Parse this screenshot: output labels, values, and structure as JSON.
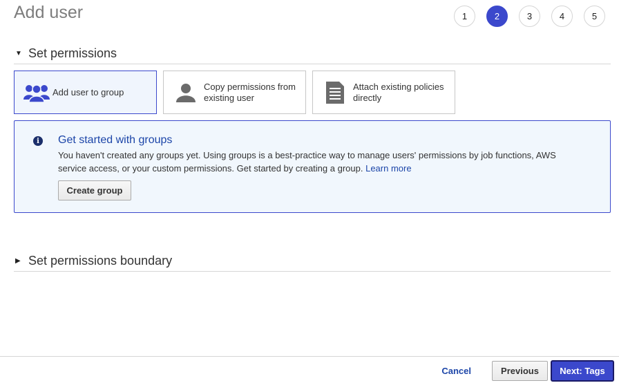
{
  "page": {
    "title": "Add user"
  },
  "stepper": {
    "steps": [
      "1",
      "2",
      "3",
      "4",
      "5"
    ],
    "active": 1
  },
  "set_permissions": {
    "header": "Set permissions",
    "options": [
      {
        "label": "Add user to group",
        "icon": "group-icon",
        "selected": true
      },
      {
        "label": "Copy permissions from existing user",
        "icon": "user-icon",
        "selected": false
      },
      {
        "label": "Attach existing policies directly",
        "icon": "document-icon",
        "selected": false
      }
    ]
  },
  "info_box": {
    "icon": "info-icon",
    "title": "Get started with groups",
    "text": "You haven't created any groups yet. Using groups is a best-practice way to manage users' permissions by job functions, AWS service access, or your custom permissions. Get started by creating a group.",
    "link": "Learn more",
    "button": "Create group"
  },
  "boundary": {
    "header": "Set permissions boundary"
  },
  "footer": {
    "cancel": "Cancel",
    "previous": "Previous",
    "next": "Next: Tags"
  },
  "colors": {
    "accent": "#3b48cc",
    "link": "#1c45a8",
    "info_bg": "#f1f7fd"
  }
}
